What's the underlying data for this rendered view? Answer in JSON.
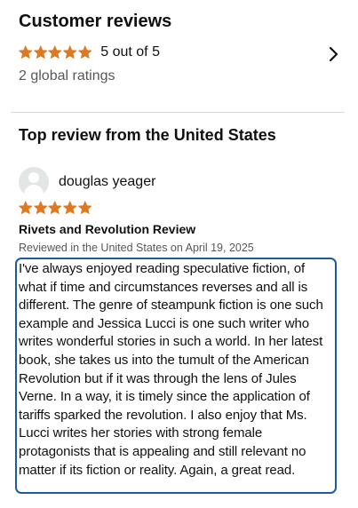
{
  "summary": {
    "title": "Customer reviews",
    "rating_value": 5,
    "rating_max": 5,
    "rating_text": "5 out of 5",
    "global_ratings": "2 global ratings",
    "chevron_icon": "chevron-right-icon"
  },
  "top_review": {
    "section_title": "Top review from the United States",
    "reviewer_name": "douglas yeager",
    "avatar_icon": "user-avatar-icon",
    "stars": 5,
    "title": "Rivets and Revolution Review",
    "meta": "Reviewed in the United States on April 19, 2025",
    "body": "I've always enjoyed reading speculative fiction, of what if time and circumstances reverses and all is different. The genre of steampunk fiction is one such example and Jessica Lucci is one such writer who writes wonderful stories in such a world. In her latest book, she takes us into the tumult of the American Revolution but if it was through the lens of Jules Verne. In a way, it is timely since the application of tariffs sparked the revolution. I also enjoy that Ms. Lucci writes her stories with strong female protagonists that is appealing and still relevant no matter if its fiction or reality. Again, a great read."
  },
  "colors": {
    "star": "#de7921",
    "text": "#0f1111",
    "secondary_text": "#565959",
    "focus_border": "#1e5aa0",
    "divider": "#d5d9d9",
    "avatar_bg": "#e3e6e6"
  }
}
